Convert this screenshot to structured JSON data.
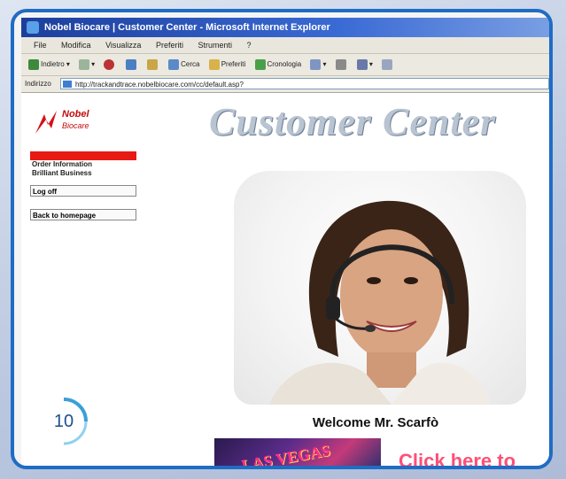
{
  "window": {
    "title": "Nobel Biocare | Customer Center - Microsoft Internet Explorer"
  },
  "menubar": {
    "items": [
      "File",
      "Modifica",
      "Visualizza",
      "Preferiti",
      "Strumenti",
      "?"
    ]
  },
  "toolbar": {
    "back_label": "Indietro",
    "search_label": "Cerca",
    "favorites_label": "Preferiti",
    "history_label": "Cronologia"
  },
  "address": {
    "label": "Indirizzo",
    "url": "http://trackandtrace.nobelbiocare.com/cc/default.asp?"
  },
  "logo": {
    "line1": "Nobel",
    "line2": "Biocare"
  },
  "sidebar": {
    "items": [
      "Order Information",
      "Brilliant Business"
    ],
    "logoff": "Log off",
    "back_home": "Back to homepage"
  },
  "page": {
    "title": "Customer Center",
    "welcome": "Welcome Mr. Scarfò",
    "banner_text": "LAS VEGAS",
    "click_here": "Click here to"
  },
  "badge": {
    "number": "10"
  },
  "colors": {
    "frame": "#1f6cc4",
    "accent_red": "#e81a14",
    "click_pink": "#ff4f76"
  }
}
